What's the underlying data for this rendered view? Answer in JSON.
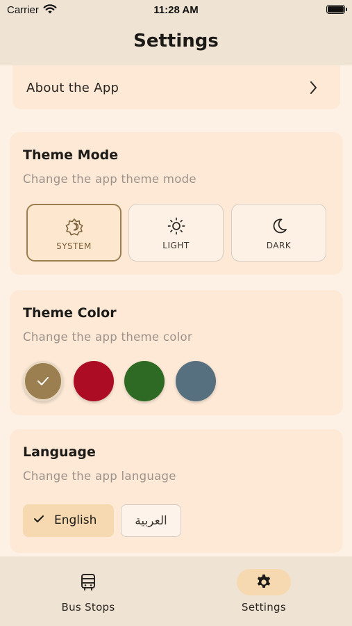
{
  "status_bar": {
    "carrier": "Carrier",
    "time": "11:28 AM"
  },
  "nav": {
    "title": "Settings"
  },
  "about": {
    "label": "About the App"
  },
  "theme_mode": {
    "title": "Theme Mode",
    "subtitle": "Change the app theme mode",
    "options": [
      {
        "label": "SYSTEM",
        "icon": "auto-brightness-icon",
        "selected": true
      },
      {
        "label": "LIGHT",
        "icon": "sun-icon",
        "selected": false
      },
      {
        "label": "DARK",
        "icon": "moon-icon",
        "selected": false
      }
    ]
  },
  "theme_color": {
    "title": "Theme Color",
    "subtitle": "Change the app theme color",
    "swatches": [
      "#9c7f50",
      "#ad0d24",
      "#2f6a24",
      "#56707f"
    ],
    "selected_index": 0
  },
  "language": {
    "title": "Language",
    "subtitle": "Change the app language",
    "options": [
      {
        "label": "English",
        "selected": true
      },
      {
        "label": "العربية",
        "selected": false
      }
    ]
  },
  "tabs": [
    {
      "label": "Bus Stops",
      "icon": "bus-icon",
      "active": false
    },
    {
      "label": "Settings",
      "icon": "gear-icon",
      "active": true
    }
  ],
  "colors": {
    "accent": "#9c7f50",
    "card": "#fde9d6",
    "background": "#fdf1e6"
  }
}
